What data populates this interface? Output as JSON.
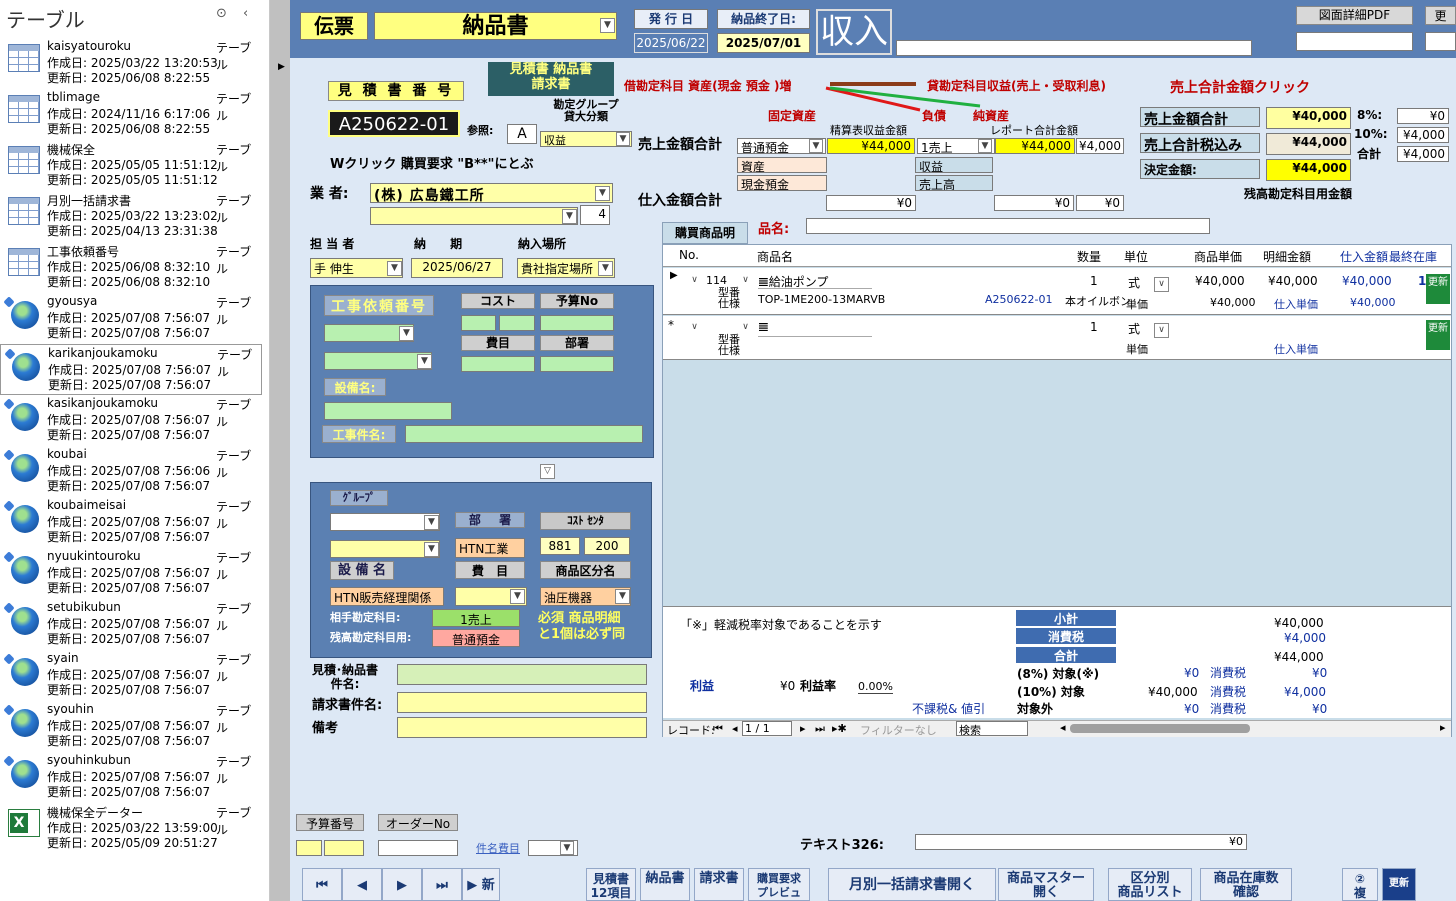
{
  "nav": {
    "title": "テーブル",
    "created_prefix": "作成日: ",
    "updated_prefix": "更新日: ",
    "items": [
      {
        "name": "kaisyatouroku",
        "type": "テーブル",
        "created": "2025/03/22 13:20:53",
        "updated": "2025/06/08 8:22:55",
        "icon": "table"
      },
      {
        "name": "tblimage",
        "type": "テーブル",
        "created": "2024/11/16 6:17:06",
        "updated": "2025/06/08 8:22:55",
        "icon": "table"
      },
      {
        "name": "機械保全",
        "type": "テーブル",
        "created": "2025/05/05 11:51:12",
        "updated": "2025/05/05 11:51:12",
        "icon": "table"
      },
      {
        "name": "月別一括請求書",
        "type": "テーブル",
        "created": "2025/03/22 13:23:02",
        "updated": "2025/04/13 23:31:38",
        "icon": "table"
      },
      {
        "name": "工事依頼番号",
        "type": "テーブル",
        "created": "2025/06/08 8:32:10",
        "updated": "2025/06/08 8:32:10",
        "icon": "table"
      },
      {
        "name": "gyousya",
        "type": "テーブル",
        "created": "2025/07/08 7:56:07",
        "updated": "2025/07/08 7:56:07",
        "icon": "globe"
      },
      {
        "name": "karikanjoukamoku",
        "type": "テーブル",
        "created": "2025/07/08 7:56:07",
        "updated": "2025/07/08 7:56:07",
        "icon": "globe"
      },
      {
        "name": "kasikanjoukamoku",
        "type": "テーブル",
        "created": "2025/07/08 7:56:07",
        "updated": "2025/07/08 7:56:07",
        "icon": "globe"
      },
      {
        "name": "koubai",
        "type": "テーブル",
        "created": "2025/07/08 7:56:06",
        "updated": "2025/07/08 7:56:07",
        "icon": "globe"
      },
      {
        "name": "koubaimeisai",
        "type": "テーブル",
        "created": "2025/07/08 7:56:07",
        "updated": "2025/07/08 7:56:07",
        "icon": "globe"
      },
      {
        "name": "nyuukintouroku",
        "type": "テーブル",
        "created": "2025/07/08 7:56:07",
        "updated": "2025/07/08 7:56:07",
        "icon": "globe"
      },
      {
        "name": "setubikubun",
        "type": "テーブル",
        "created": "2025/07/08 7:56:07",
        "updated": "2025/07/08 7:56:07",
        "icon": "globe"
      },
      {
        "name": "syain",
        "type": "テーブル",
        "created": "2025/07/08 7:56:07",
        "updated": "2025/07/08 7:56:07",
        "icon": "globe"
      },
      {
        "name": "syouhin",
        "type": "テーブル",
        "created": "2025/07/08 7:56:07",
        "updated": "2025/07/08 7:56:07",
        "icon": "globe"
      },
      {
        "name": "syouhinkubun",
        "type": "テーブル",
        "created": "2025/07/08 7:56:07",
        "updated": "2025/07/08 7:56:07",
        "icon": "globe"
      },
      {
        "name": "機械保全データー",
        "type": "テーブル",
        "created": "2025/03/22 13:59:00",
        "updated": "2025/05/09 20:51:27",
        "icon": "excel"
      }
    ]
  },
  "header": {
    "denpyo": "伝票",
    "doc_type": "納品書",
    "issue_label": "発 行 日",
    "issue_date": "2025/06/22",
    "delivery_end_label": "納品終了日:",
    "delivery_end_date": "2025/07/01",
    "income": "収入",
    "pdf_btn": "図面詳細PDF",
    "update_btn": "更"
  },
  "left": {
    "est_no_label": "見 積 書 番 号",
    "est_no": "A250622-01",
    "est_types": "見積書 納品書\n請求書",
    "ref_label": "参照:",
    "ref_val": "A",
    "group_label": "勘定グループ\n貸大分類",
    "group_val": "収益",
    "dblclick": "Wクリック 購買要求 \"B**\"にとぶ",
    "vendor_label": "業 者:",
    "vendor": "(株) 広島鐵工所",
    "qty_small": "4",
    "staff_label": "担 当 者",
    "period_label": "納 期",
    "place_label": "納入場所",
    "staff": "手 伸生",
    "period": "2025/06/27",
    "place": "貴社指定場所"
  },
  "ledger": {
    "debit_label": "借勘定科目 資産(現金 預金 )増",
    "credit_label": "貸勘定科目収益(売上・受取利息)",
    "fixed_asset": "固定資産",
    "liability": "負債",
    "net_asset": "純資産",
    "sales_total_label": "売上金額合計",
    "purchase_total_label": "仕入金額合計",
    "settle_label": "精算表収益金額",
    "report_label": "レポート合計金額",
    "acct1": "普通預金",
    "amt1": "¥44,000",
    "acct2": "1売上",
    "amt2": "¥44,000",
    "amt3": "¥4,000",
    "asset": "資産",
    "income": "収益",
    "cash_deposit": "現金預金",
    "sales_high": "売上高",
    "p1": "¥0",
    "p2": "¥0",
    "p3": "¥0",
    "click_label": "売上合計金額クリック",
    "sales_sum_label": "売上金額合計",
    "sales_sum": "¥40,000",
    "sales_tax_label": "売上合計税込み",
    "sales_tax": "¥44,000",
    "final_label": "決定金額:",
    "final": "¥44,000",
    "r8_label": "8%:",
    "r8": "¥0",
    "r10_label": "10%:",
    "r10": "¥4,000",
    "sum_label": "合計",
    "sum": "¥4,000",
    "balance_note": "残高勘定科目用金額"
  },
  "detail": {
    "item_label": "品名:",
    "tab": "購買商品明",
    "cols": [
      "No.",
      "商品名",
      "数量",
      "単位",
      "商品単価",
      "明細金額",
      "仕入金額",
      "最終在庫"
    ],
    "row1": {
      "no": "114",
      "name": "𝌆給油ポンプ",
      "qty": "1",
      "unit": "式",
      "price": "¥40,000",
      "amount": "¥40,000",
      "cost": "¥40,000",
      "stock": "1",
      "model_label": "型番\n仕様",
      "model": "TOP-1ME200-13MARVB",
      "est": "A250622-01",
      "maker": "本オイルボン",
      "unit_price_label": "単価",
      "unit_price": "¥40,000",
      "cost_price_label": "仕入単価",
      "cost_price": "¥40,000",
      "btn": "更新"
    },
    "row2": {
      "name": "𝌆",
      "qty": "1",
      "unit": "式",
      "model_label": "型番\n仕様",
      "unit_price_label": "単価",
      "cost_price_label": "仕入単価",
      "btn": "更新"
    },
    "footnote": "「※」軽減税率対象であることを示す",
    "subtotal_label": "小計",
    "subtotal": "¥40,000",
    "tax_label": "消費税",
    "tax": "¥4,000",
    "total_label": "合計",
    "total": "¥44,000",
    "profit_label": "利益",
    "profit": "¥0",
    "profit_rate_label": "利益率",
    "profit_rate": "0.00%",
    "r8_label": "(8%) 対象(※)",
    "r8": "¥0",
    "r8_tax_label": "消費税",
    "r8_tax": "¥0",
    "r10_label": "(10%) 対象",
    "r10": "¥40,000",
    "r10_tax_label": "消費税",
    "r10_tax": "¥4,000",
    "nontax_label": "不課税& 値引",
    "exempt_label": "対象外",
    "exempt": "¥0",
    "exempt_tax_label": "消費税",
    "exempt_tax": "¥0",
    "record_label": "レコード:",
    "record": "1 / 1",
    "filter": "フィルターなし",
    "search": "検索"
  },
  "work": {
    "req_no": "工事依頼番号",
    "cost": "コスト",
    "budget": "予算No",
    "expense": "費目",
    "dept": "部署",
    "equipment_label": "設備名:",
    "work_name_label": "工事件名:"
  },
  "group": {
    "group_label": "ｸﾞﾙｰﾌﾟ",
    "dept_label": "部 署",
    "cost_center": "ｺｽﾄ ｾﾝﾀ",
    "dept_val": "HTN工業",
    "cc1": "881",
    "cc2": "200",
    "equip_label": "設 備 名",
    "expense_label": "費 目",
    "category_label": "商品区分名",
    "equip_val": "HTN販売経理関係",
    "category_val": "油圧機器",
    "partner_label": "相手勘定科目:",
    "partner_val": "1売上",
    "balance_label": "残高勘定科目用:",
    "balance_val": "普通預金",
    "must": "必須 商品明細\nと1個は必ず同"
  },
  "bottom": {
    "est_name": "見積･納品書\n件名:",
    "inv_name": "請求書件名:",
    "memo": "備考",
    "budget_no": "予算番号",
    "order_no": "オーダーNo",
    "item_cost": "件名費目",
    "text326": "テキスト326:",
    "text326_val": "¥0"
  },
  "navbtns": {
    "first": "⏮",
    "prev": "◀",
    "next": "▶",
    "last": "⏭",
    "new": "▶ 新",
    "est12": "見積書\n12項目",
    "delivery": "納品書",
    "invoice": "請求書",
    "preview": "購買要求\nプレビュ",
    "monthly": "月別一括請求書開く",
    "master": "商品マスター\n開く",
    "category": "区分別\n商品リスト",
    "stock": "商品在庫数\n確認",
    "help": "②\n複",
    "refresh": "更新"
  }
}
